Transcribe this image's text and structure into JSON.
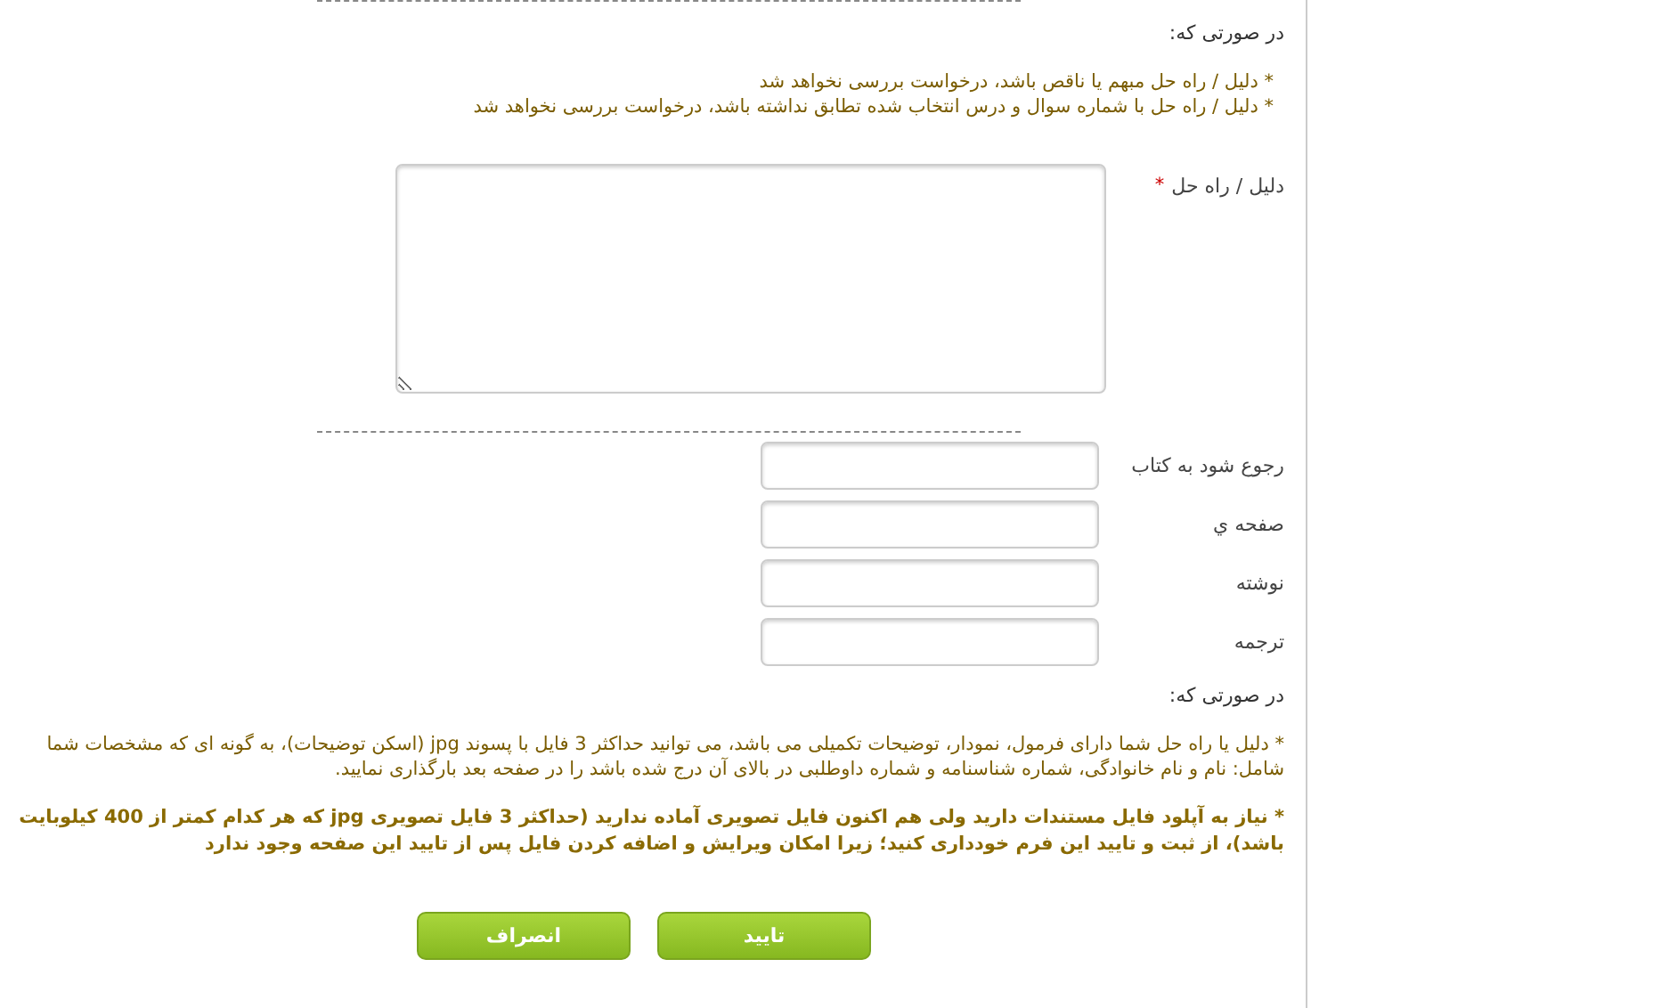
{
  "notice_top": {
    "heading": "در صورتی که:",
    "items": [
      "* دلیل / راه حل مبهم یا ناقص باشد، درخواست بررسی نخواهد شد",
      "* دلیل / راه حل با شماره سوال و درس انتخاب شده تطابق نداشته باشد، درخواست بررسی نخواهد شد"
    ]
  },
  "solution": {
    "label": "دلیل / راه حل",
    "required_mark": "*"
  },
  "reference_fields": [
    {
      "label": "رجوع شود به کتاب"
    },
    {
      "label": "صفحه ي"
    },
    {
      "label": "نوشته"
    },
    {
      "label": "ترجمه"
    }
  ],
  "notice_bottom": {
    "heading": "در صورتی که:",
    "paragraph": "* دلیل یا راه حل شما دارای فرمول، نمودار، توضیحات تکمیلی می باشد، می توانید حداکثر 3 فایل با پسوند jpg (اسکن توضیحات)، به گونه ای که مشخصات شما شامل: نام و نام خانوادگی، شماره شناسنامه و شماره داوطلبی در بالای آن درج شده باشد را در صفحه بعد بارگذاری نمایید.",
    "warning": "* نیاز به آپلود فایل مستندات دارید ولی هم اکنون فایل تصویری آماده ندارید (حداکثر 3 فایل تصویری jpg که هر کدام کمتر از 400 کیلوبایت باشد)، از ثبت و تایید این فرم خودداری کنید؛ زیرا امکان ویرایش و اضافه کردن فایل پس از تایید این صفحه وجود ندارد"
  },
  "buttons": [
    {
      "label": "تایید"
    },
    {
      "label": "انصراف"
    }
  ]
}
